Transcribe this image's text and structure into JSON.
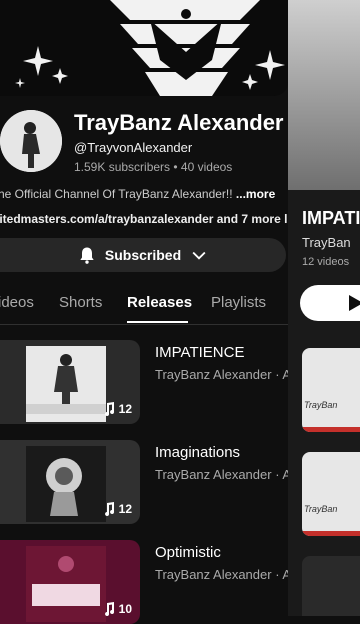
{
  "channel": {
    "name": "TrayBanz Alexander",
    "handle": "@TrayvonAlexander",
    "stats": "1.59K subscribers • 40 videos",
    "description": "he Official Channel Of TrayBanz Alexander!! ",
    "more_label": "...more",
    "links": "nitedmasters.com/a/traybanzalexander and 7 more lin",
    "subscribe_label": "Subscribed"
  },
  "tabs": [
    "ideos",
    "Shorts",
    "Releases",
    "Playlists"
  ],
  "active_tab": "Releases",
  "releases": [
    {
      "title": "IMPATIENCE",
      "subtitle": "TrayBanz Alexander · Al",
      "count": "12",
      "art_text": "TrayBanz Alexander"
    },
    {
      "title": "Imaginations",
      "subtitle": "TrayBanz Alexander · Al",
      "count": "12",
      "art_text": ""
    },
    {
      "title": "Optimistic",
      "subtitle": "TrayBanz Alexander · Al",
      "count": "10",
      "art_text": "OPTIMISTIC"
    }
  ],
  "side_panel": {
    "title": "IMPATI",
    "artist": "TrayBan",
    "count": "12 videos",
    "thumb_text": "TrayBan"
  },
  "colors": {
    "background": "#0f0f0f",
    "accent": "#c4302b",
    "thumb_maroon": "#5a0f2e"
  },
  "icons": [
    "bell-icon",
    "chevron-down-icon",
    "music-note-icon",
    "play-icon"
  ]
}
